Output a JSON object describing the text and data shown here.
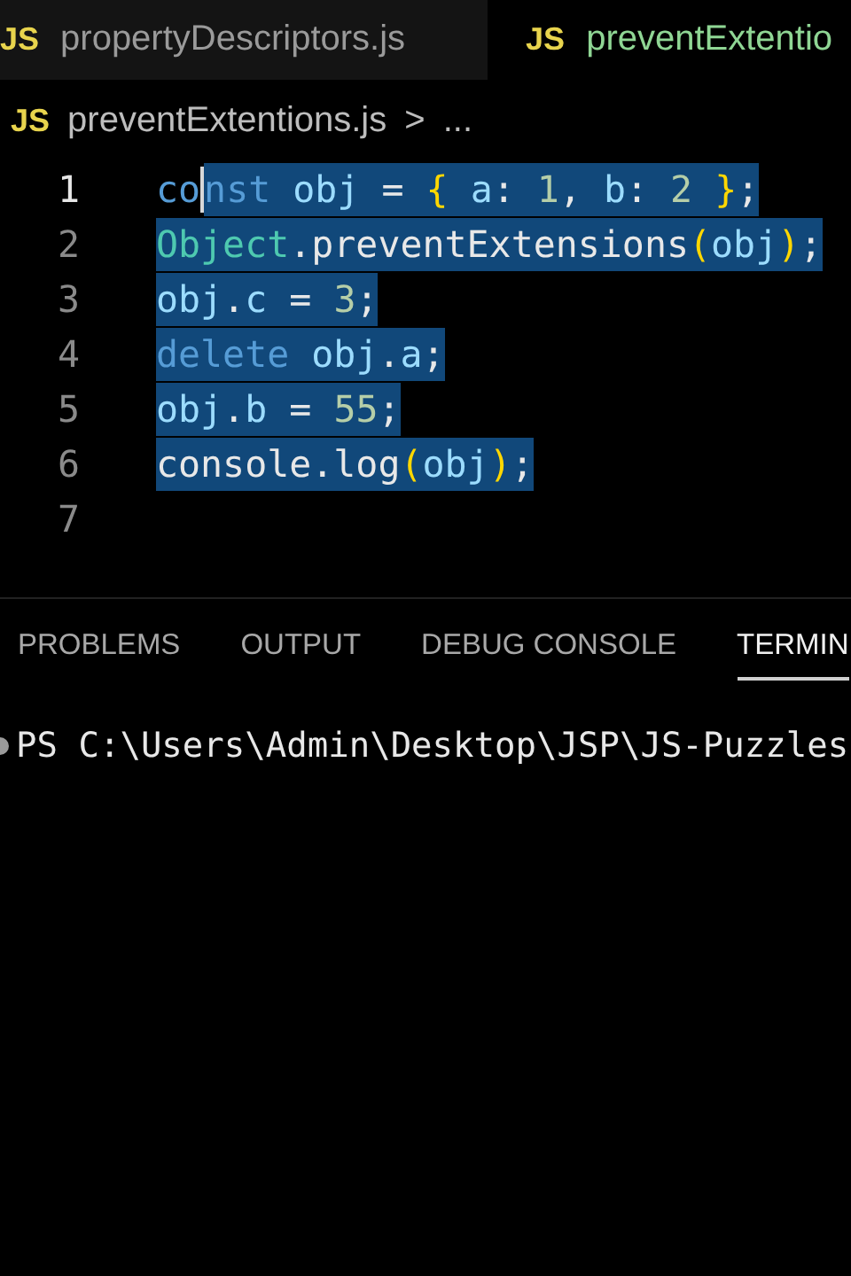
{
  "editor_tabs": [
    {
      "icon": "JS",
      "label": "propertyDescriptors.js",
      "selected": false
    },
    {
      "icon": "JS",
      "label": "preventExtentio",
      "selected": true
    }
  ],
  "breadcrumb": {
    "icon": "JS",
    "file": "preventExtentions.js",
    "separator": ">",
    "more": "..."
  },
  "lines": [
    {
      "number": "1",
      "active": true,
      "tokens": [
        {
          "kind": "keyword",
          "text": "co",
          "selected": false,
          "caret_after": true
        },
        {
          "kind": "keyword",
          "text": "nst ",
          "selected": true
        },
        {
          "kind": "variable",
          "text": "obj",
          "selected": true
        },
        {
          "kind": "punct",
          "text": " = ",
          "selected": true
        },
        {
          "kind": "brace",
          "text": "{",
          "selected": true
        },
        {
          "kind": "variable",
          "text": " a",
          "selected": true
        },
        {
          "kind": "punct",
          "text": ": ",
          "selected": true
        },
        {
          "kind": "number",
          "text": "1",
          "selected": true
        },
        {
          "kind": "punct",
          "text": ", ",
          "selected": true
        },
        {
          "kind": "variable",
          "text": "b",
          "selected": true
        },
        {
          "kind": "punct",
          "text": ": ",
          "selected": true
        },
        {
          "kind": "number",
          "text": "2 ",
          "selected": true
        },
        {
          "kind": "brace",
          "text": "}",
          "selected": true
        },
        {
          "kind": "punct",
          "text": ";",
          "selected": true
        }
      ]
    },
    {
      "number": "2",
      "active": false,
      "tokens": [
        {
          "kind": "class",
          "text": "Object",
          "selected": true
        },
        {
          "kind": "punct",
          "text": ".preventExtensions",
          "selected": true
        },
        {
          "kind": "brace",
          "text": "(",
          "selected": true
        },
        {
          "kind": "variable",
          "text": "obj",
          "selected": true
        },
        {
          "kind": "brace",
          "text": ")",
          "selected": true
        },
        {
          "kind": "punct",
          "text": ";",
          "selected": true
        }
      ]
    },
    {
      "number": "3",
      "active": false,
      "tokens": [
        {
          "kind": "variable",
          "text": "obj",
          "selected": true
        },
        {
          "kind": "punct",
          "text": ".",
          "selected": true
        },
        {
          "kind": "variable",
          "text": "c",
          "selected": true
        },
        {
          "kind": "punct",
          "text": " = ",
          "selected": true
        },
        {
          "kind": "number",
          "text": "3",
          "selected": true
        },
        {
          "kind": "punct",
          "text": ";",
          "selected": true
        }
      ]
    },
    {
      "number": "4",
      "active": false,
      "tokens": [
        {
          "kind": "keyword",
          "text": "delete ",
          "selected": true
        },
        {
          "kind": "variable",
          "text": "obj",
          "selected": true
        },
        {
          "kind": "punct",
          "text": ".",
          "selected": true
        },
        {
          "kind": "variable",
          "text": "a",
          "selected": true
        },
        {
          "kind": "punct",
          "text": ";",
          "selected": true
        }
      ]
    },
    {
      "number": "5",
      "active": false,
      "tokens": [
        {
          "kind": "variable",
          "text": "obj",
          "selected": true
        },
        {
          "kind": "punct",
          "text": ".",
          "selected": true
        },
        {
          "kind": "variable",
          "text": "b",
          "selected": true
        },
        {
          "kind": "punct",
          "text": " = ",
          "selected": true
        },
        {
          "kind": "number",
          "text": "55",
          "selected": true
        },
        {
          "kind": "punct",
          "text": ";",
          "selected": true
        }
      ]
    },
    {
      "number": "6",
      "active": false,
      "tokens": [
        {
          "kind": "punct",
          "text": "console.log",
          "selected": true
        },
        {
          "kind": "brace",
          "text": "(",
          "selected": true
        },
        {
          "kind": "variable",
          "text": "obj",
          "selected": true
        },
        {
          "kind": "brace",
          "text": ")",
          "selected": true
        },
        {
          "kind": "punct",
          "text": ";",
          "selected": true
        }
      ]
    },
    {
      "number": "7",
      "active": false
    }
  ],
  "panel_tabs": [
    {
      "label": "PROBLEMS",
      "selected": false
    },
    {
      "label": "OUTPUT",
      "selected": false
    },
    {
      "label": "DEBUG CONSOLE",
      "selected": false
    },
    {
      "label": "TERMIN",
      "selected": true
    }
  ],
  "terminal": {
    "prompt": "PS C:\\Users\\Admin\\Desktop\\JSP\\JS-Puzzles"
  }
}
